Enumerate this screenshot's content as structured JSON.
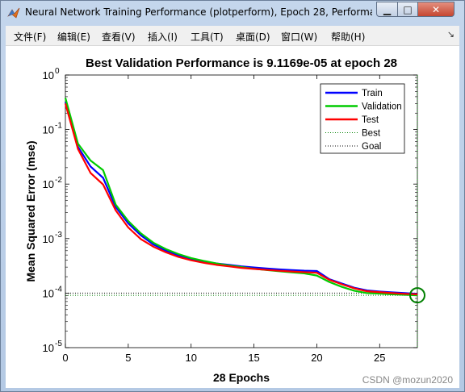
{
  "window": {
    "title": "Neural Network Training Performance (plotperform), Epoch 28, Performa...",
    "min_label": "▁",
    "max_label": "□",
    "close_label": "✕"
  },
  "menu": {
    "items": [
      "文件(F)",
      "编辑(E)",
      "查看(V)",
      "插入(I)",
      "工具(T)",
      "桌面(D)",
      "窗口(W)",
      "帮助(H)"
    ],
    "dock_symbol": "↘"
  },
  "chart_data": {
    "type": "line",
    "title": "Best Validation Performance is 9.1169e-05 at epoch 28",
    "xlabel": "28 Epochs",
    "ylabel": "Mean Squared Error  (mse)",
    "xlim": [
      0,
      28
    ],
    "ylim": [
      1e-05,
      1
    ],
    "yscale": "log",
    "x_ticks": [
      0,
      5,
      10,
      15,
      20,
      25
    ],
    "y_ticks": [
      {
        "value": 1e-05,
        "base": "10",
        "exp": "-5"
      },
      {
        "value": 0.0001,
        "base": "10",
        "exp": "-4"
      },
      {
        "value": 0.001,
        "base": "10",
        "exp": "-3"
      },
      {
        "value": 0.01,
        "base": "10",
        "exp": "-2"
      },
      {
        "value": 0.1,
        "base": "10",
        "exp": "-1"
      },
      {
        "value": 1,
        "base": "10",
        "exp": "0"
      }
    ],
    "grid": false,
    "legend_position": "top-right",
    "x": [
      0,
      1,
      2,
      3,
      4,
      5,
      6,
      7,
      8,
      9,
      10,
      11,
      12,
      13,
      14,
      15,
      16,
      17,
      18,
      19,
      20,
      21,
      22,
      23,
      24,
      25,
      26,
      27,
      28
    ],
    "series": [
      {
        "name": "Train",
        "color": "#0000ff",
        "values": [
          0.32,
          0.048,
          0.021,
          0.013,
          0.0038,
          0.0019,
          0.00115,
          0.00078,
          0.0006,
          0.00049,
          0.00042,
          0.00038,
          0.00035,
          0.00033,
          0.00031,
          0.000295,
          0.000283,
          0.000273,
          0.000265,
          0.000258,
          0.000255,
          0.00018,
          0.00015,
          0.000125,
          0.000112,
          0.000107,
          0.000103,
          0.0001,
          9.7e-05
        ]
      },
      {
        "name": "Validation",
        "color": "#00cc00",
        "values": [
          0.38,
          0.055,
          0.027,
          0.018,
          0.0042,
          0.0021,
          0.00125,
          0.00084,
          0.00064,
          0.00052,
          0.00044,
          0.00039,
          0.00035,
          0.00032,
          0.0003,
          0.00028,
          0.000265,
          0.000252,
          0.00024,
          0.00023,
          0.00021,
          0.00016,
          0.00013,
          0.00011,
          0.0001,
          9.8e-05,
          9.5e-05,
          9.3e-05,
          9.1169e-05
        ]
      },
      {
        "name": "Test",
        "color": "#ff0000",
        "values": [
          0.3,
          0.044,
          0.016,
          0.0098,
          0.0033,
          0.0016,
          0.00098,
          0.00071,
          0.00056,
          0.00046,
          0.0004,
          0.00036,
          0.00033,
          0.00031,
          0.00029,
          0.000278,
          0.000267,
          0.000257,
          0.000249,
          0.000242,
          0.000236,
          0.000175,
          0.000145,
          0.000122,
          0.000108,
          0.000104,
          0.0001,
          9.7e-05,
          9.5e-05
        ]
      }
    ],
    "best": {
      "name": "Best",
      "epoch": 28,
      "value": 9.1169e-05,
      "color": "#008000"
    },
    "goal": {
      "name": "Goal",
      "value": 0.0001,
      "color": "#000000"
    }
  },
  "watermark": "CSDN @mozun2020"
}
